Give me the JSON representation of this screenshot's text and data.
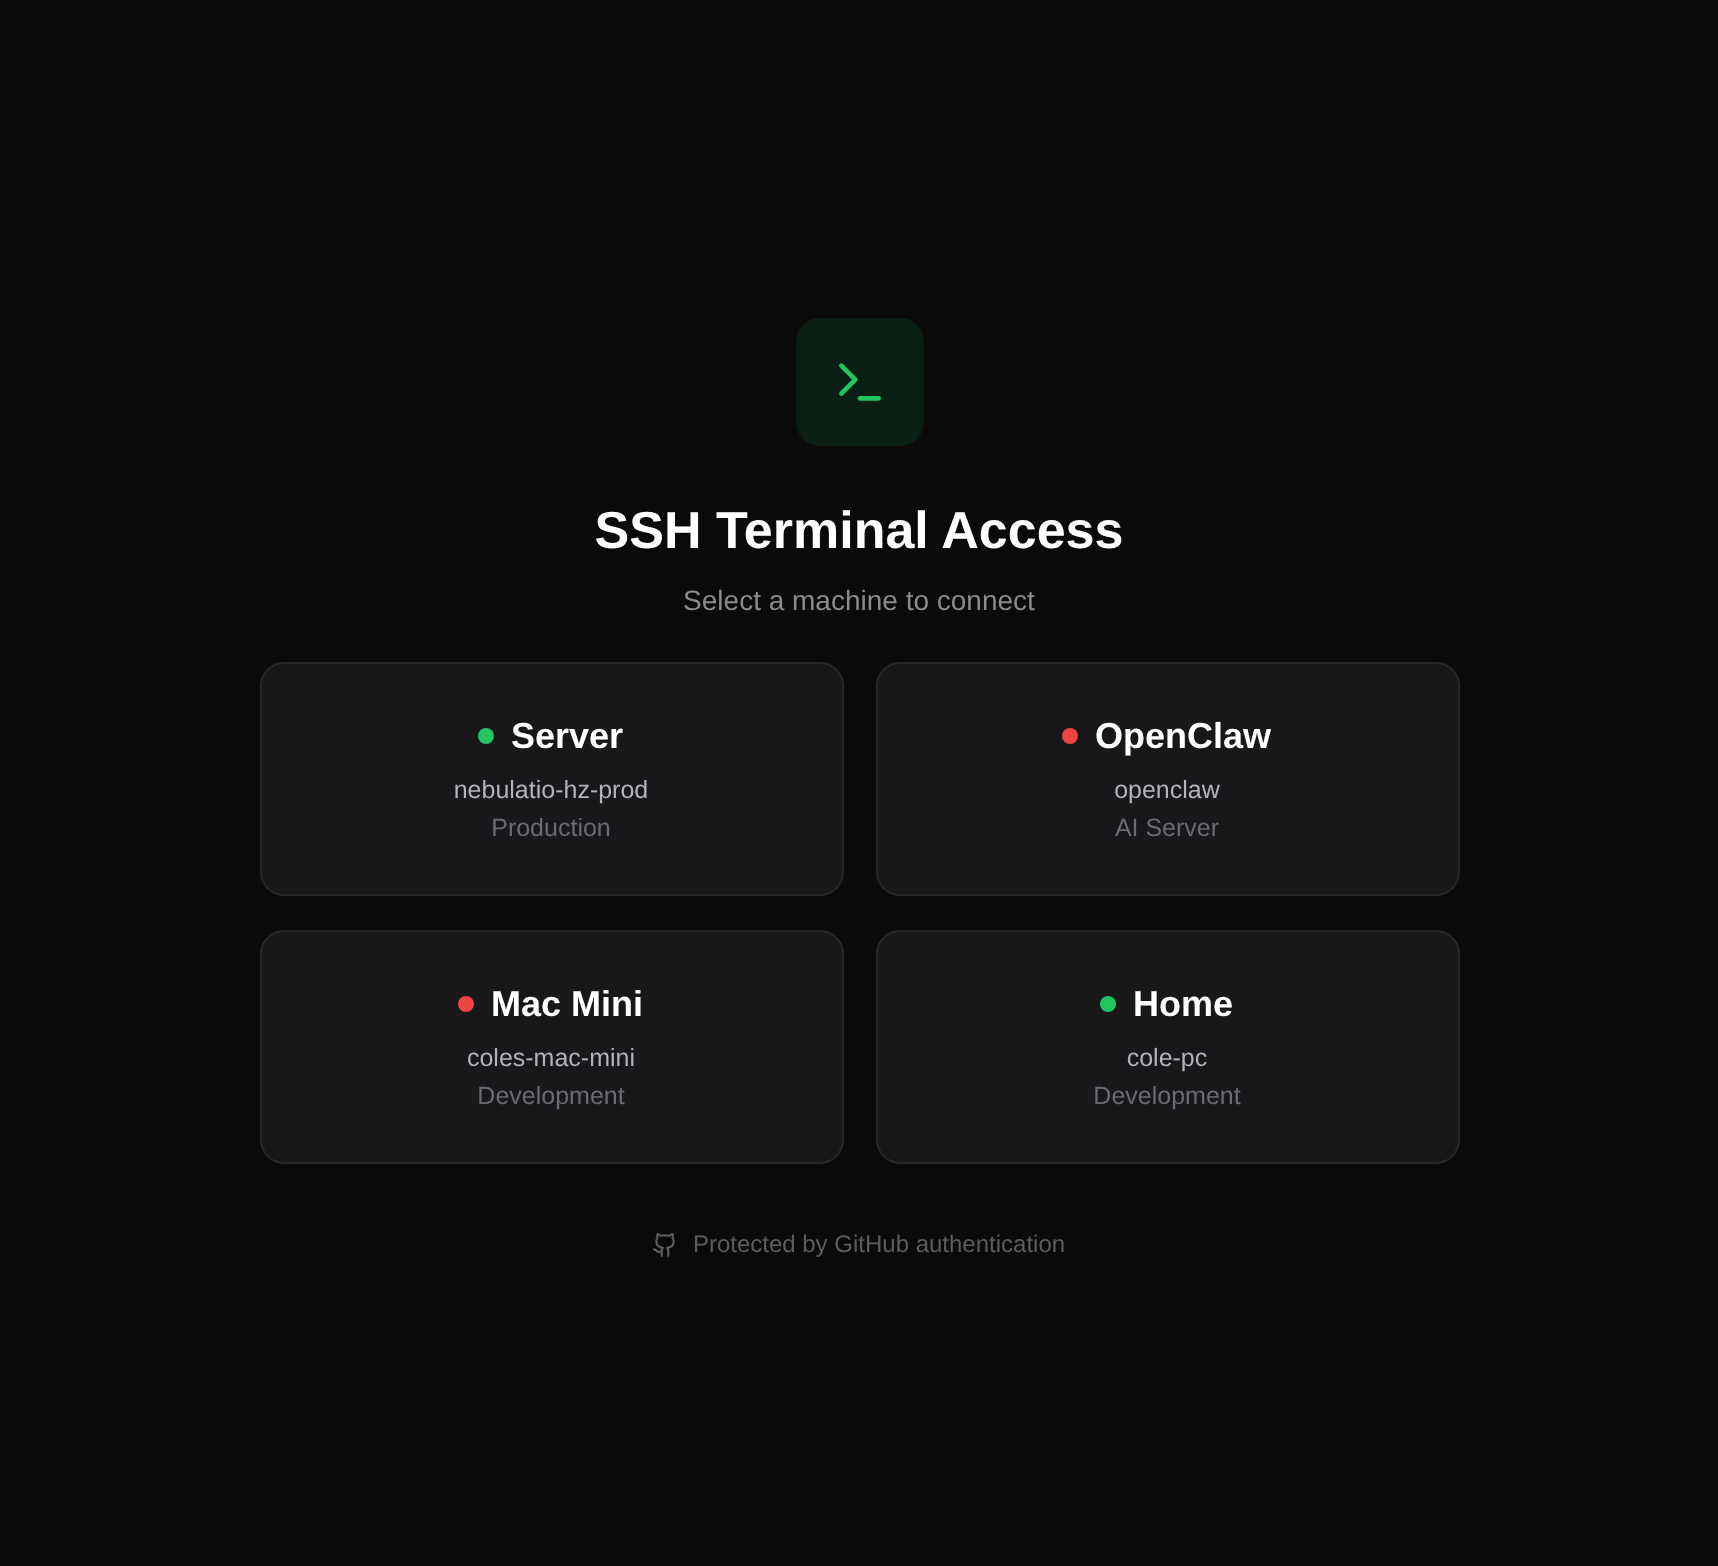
{
  "header": {
    "title": "SSH Terminal Access",
    "subtitle": "Select a machine to connect"
  },
  "machines": [
    {
      "name": "Server",
      "host": "nebulatio-hz-prod",
      "role": "Production",
      "color": "#22c55e"
    },
    {
      "name": "OpenClaw",
      "host": "openclaw",
      "role": "AI Server",
      "color": "#ef4444"
    },
    {
      "name": "Mac Mini",
      "host": "coles-mac-mini",
      "role": "Development",
      "color": "#ef4444"
    },
    {
      "name": "Home",
      "host": "cole-pc",
      "role": "Development",
      "color": "#22c55e"
    }
  ],
  "footer": {
    "text": "Protected by GitHub authentication"
  }
}
